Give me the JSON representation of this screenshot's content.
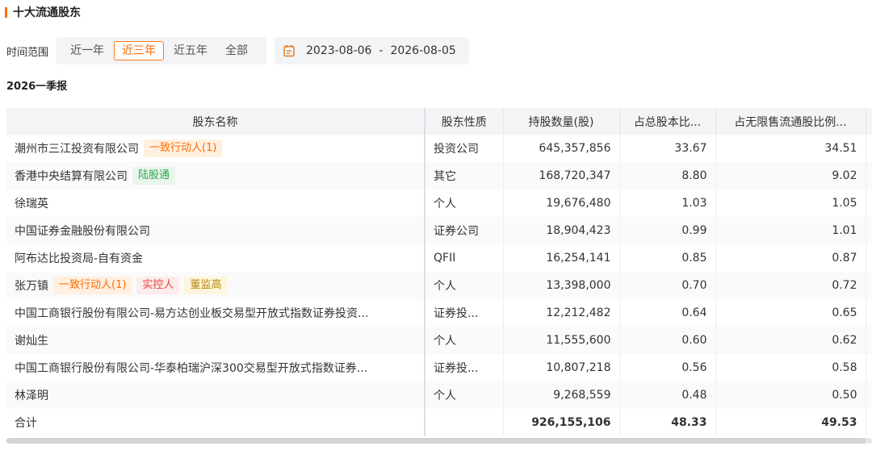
{
  "section": {
    "title": "十大流通股东"
  },
  "filter": {
    "label": "时间范围",
    "ranges": [
      {
        "label": "近一年",
        "active": false
      },
      {
        "label": "近三年",
        "active": true
      },
      {
        "label": "近五年",
        "active": false
      },
      {
        "label": "全部",
        "active": false
      }
    ],
    "date_start": "2023-08-06",
    "date_sep": "-",
    "date_end": "2026-08-05",
    "date_icon": "calendar-icon"
  },
  "period": "2026一季报",
  "table": {
    "headers": [
      "股东名称",
      "股东性质",
      "持股数量(股)",
      "占总股本比...",
      "占无限售流通股比例..."
    ],
    "rows": [
      {
        "name": "潮州市三江投资有限公司",
        "tags": [
          {
            "text": "一致行动人(1)",
            "color": "orange"
          }
        ],
        "type": "投资公司",
        "shares": "645,357,856",
        "pct_total": "33.67",
        "pct_float": "34.51"
      },
      {
        "name": "香港中央结算有限公司",
        "tags": [
          {
            "text": "陆股通",
            "color": "green"
          }
        ],
        "type": "其它",
        "shares": "168,720,347",
        "pct_total": "8.80",
        "pct_float": "9.02"
      },
      {
        "name": "徐瑞英",
        "tags": [],
        "type": "个人",
        "shares": "19,676,480",
        "pct_total": "1.03",
        "pct_float": "1.05"
      },
      {
        "name": "中国证券金融股份有限公司",
        "tags": [],
        "type": "证券公司",
        "shares": "18,904,423",
        "pct_total": "0.99",
        "pct_float": "1.01"
      },
      {
        "name": "阿布达比投资局-自有资金",
        "tags": [],
        "type": "QFII",
        "shares": "16,254,141",
        "pct_total": "0.85",
        "pct_float": "0.87"
      },
      {
        "name": "张万镇",
        "tags": [
          {
            "text": "一致行动人(1)",
            "color": "orange"
          },
          {
            "text": "实控人",
            "color": "red"
          },
          {
            "text": "董监高",
            "color": "yellow"
          }
        ],
        "type": "个人",
        "shares": "13,398,000",
        "pct_total": "0.70",
        "pct_float": "0.72"
      },
      {
        "name": "中国工商银行股份有限公司-易方达创业板交易型开放式指数证券投资...",
        "tags": [],
        "type": "证券投...",
        "shares": "12,212,482",
        "pct_total": "0.64",
        "pct_float": "0.65"
      },
      {
        "name": "谢灿生",
        "tags": [],
        "type": "个人",
        "shares": "11,555,600",
        "pct_total": "0.60",
        "pct_float": "0.62"
      },
      {
        "name": "中国工商银行股份有限公司-华泰柏瑞沪深300交易型开放式指数证券...",
        "tags": [],
        "type": "证券投...",
        "shares": "10,807,218",
        "pct_total": "0.56",
        "pct_float": "0.58"
      },
      {
        "name": "林泽明",
        "tags": [],
        "type": "个人",
        "shares": "9,268,559",
        "pct_total": "0.48",
        "pct_float": "0.50"
      }
    ],
    "total": {
      "label": "合计",
      "shares": "926,155,106",
      "pct_total": "48.33",
      "pct_float": "49.53"
    }
  },
  "colors": {
    "accent": "#ff6a00",
    "header_bg": "#f3f4f6"
  }
}
